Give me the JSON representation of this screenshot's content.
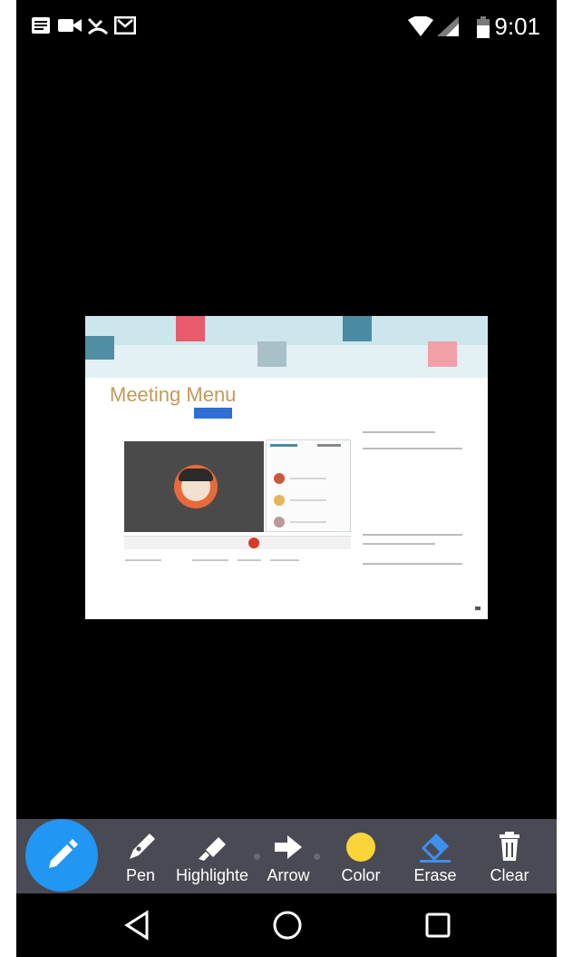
{
  "status_bar": {
    "time": "9:01",
    "left_icons": [
      "notes-icon",
      "video-camera-icon",
      "missed-call-icon",
      "mail-icon"
    ],
    "right_icons": [
      "wifi-icon",
      "signal-icon",
      "battery-icon"
    ]
  },
  "slide": {
    "title": "Meeting Menu"
  },
  "annotation_toolbar": {
    "fab_icon": "pencil-icon",
    "tools": [
      {
        "label": "Pen",
        "icon": "pen-icon"
      },
      {
        "label": "Highlighte",
        "icon": "highlighter-icon"
      },
      {
        "label": "Arrow",
        "icon": "arrow-icon"
      },
      {
        "label": "Color",
        "icon": "color-swatch-icon",
        "color": "#fbd43a"
      },
      {
        "label": "Erase",
        "icon": "eraser-icon",
        "color": "#3d8ff0"
      },
      {
        "label": "Clear",
        "icon": "trash-icon"
      }
    ]
  },
  "nav_bar": {
    "buttons": [
      "back-icon",
      "home-icon",
      "recents-icon"
    ]
  },
  "colors": {
    "toolbar_bg": "#4a4a55",
    "fab": "#2196f3",
    "screen_bg": "#000000"
  }
}
